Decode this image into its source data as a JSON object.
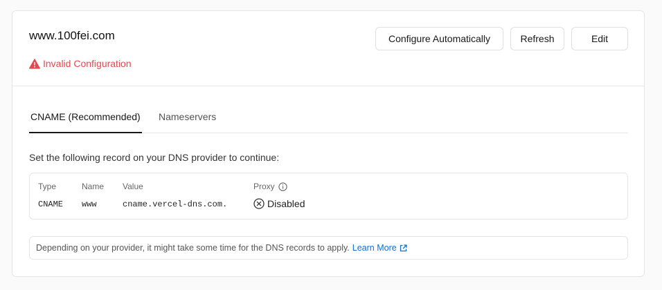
{
  "domain": "www.100fei.com",
  "status": {
    "text": "Invalid Configuration",
    "color": "#e5484d",
    "icon": "warning-icon"
  },
  "actions": {
    "configure": "Configure Automatically",
    "refresh": "Refresh",
    "edit": "Edit"
  },
  "tabs": [
    {
      "label": "CNAME (Recommended)",
      "active": true
    },
    {
      "label": "Nameservers",
      "active": false
    }
  ],
  "instruction": "Set the following record on your DNS provider to continue:",
  "record": {
    "headers": {
      "type": "Type",
      "name": "Name",
      "value": "Value",
      "proxy": "Proxy"
    },
    "values": {
      "type": "CNAME",
      "name": "www",
      "value": "cname.vercel-dns.com.",
      "proxy": "Disabled"
    }
  },
  "note": {
    "text": "Depending on your provider, it might take some time for the DNS records to apply.",
    "link": "Learn More",
    "link_color": "#0b6fd6"
  }
}
